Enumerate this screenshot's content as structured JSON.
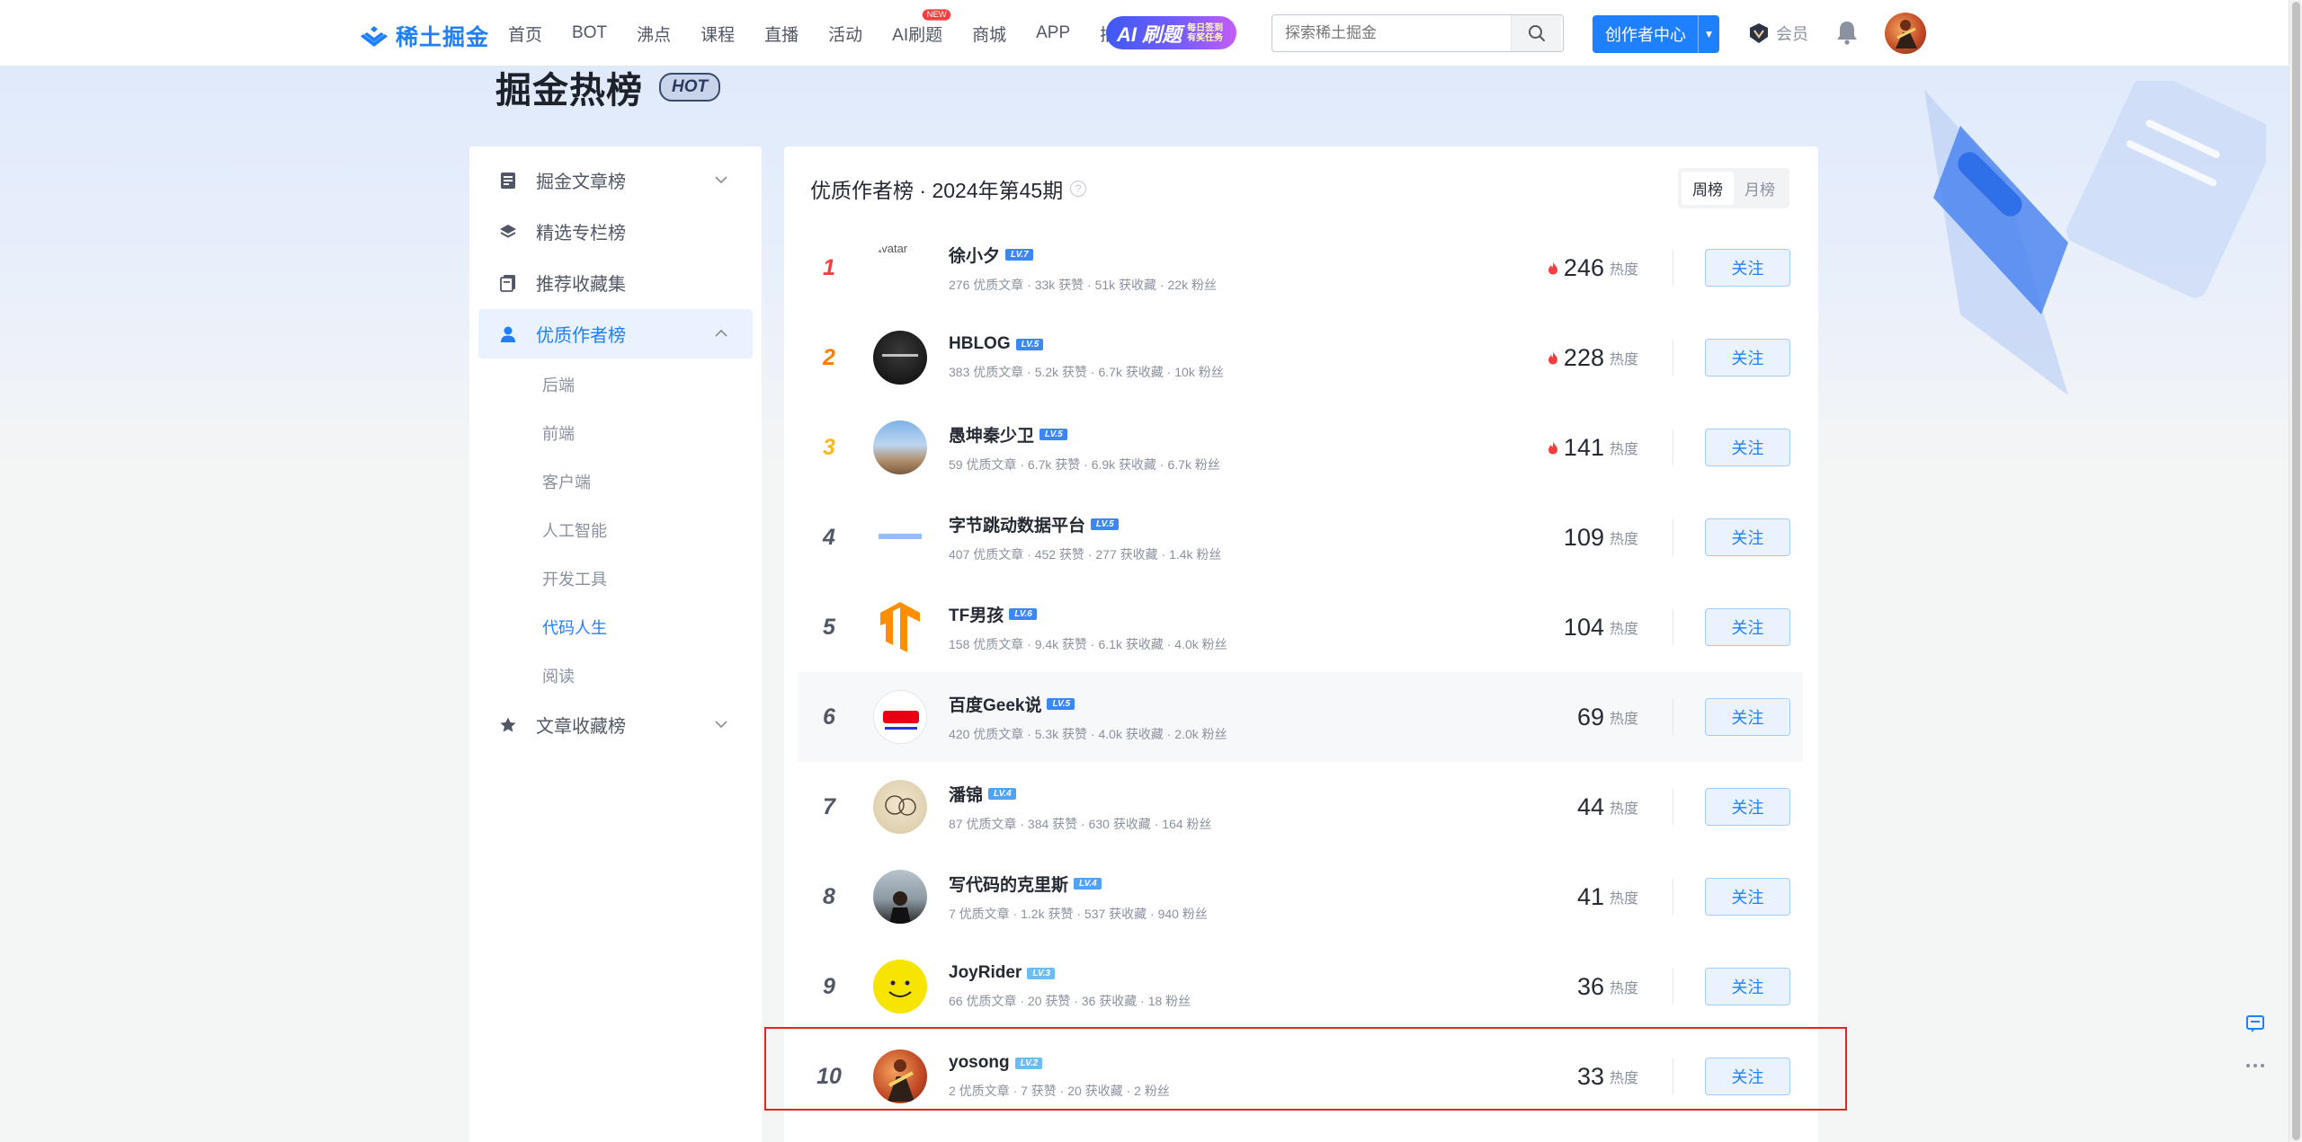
{
  "nav": {
    "logo_text": "稀土掘金",
    "items": [
      {
        "label": "首页"
      },
      {
        "label": "BOT"
      },
      {
        "label": "沸点"
      },
      {
        "label": "课程"
      },
      {
        "label": "直播"
      },
      {
        "label": "活动"
      },
      {
        "label": "AI刷题",
        "badge": "NEW"
      },
      {
        "label": "商城"
      },
      {
        "label": "APP"
      },
      {
        "label": "插件"
      }
    ],
    "ai_banner": {
      "big": "AI 刷题",
      "line1": "每日签到",
      "line2": "有奖任务"
    },
    "search_placeholder": "探索稀土掘金",
    "creator_label": "创作者中心",
    "vip_label": "会员"
  },
  "hero": {
    "title": "掘金热榜",
    "badge": "HOT"
  },
  "sidebar": {
    "items": [
      {
        "label": "掘金文章榜",
        "icon": "document-icon",
        "expanded": false
      },
      {
        "label": "精选专栏榜",
        "icon": "layers-icon"
      },
      {
        "label": "推荐收藏集",
        "icon": "collection-icon"
      },
      {
        "label": "优质作者榜",
        "icon": "user-icon",
        "expanded": true,
        "active": true
      },
      {
        "label": "文章收藏榜",
        "icon": "star-icon",
        "expanded": false
      }
    ],
    "sub_items": [
      {
        "label": "后端"
      },
      {
        "label": "前端"
      },
      {
        "label": "客户端"
      },
      {
        "label": "人工智能"
      },
      {
        "label": "开发工具"
      },
      {
        "label": "代码人生",
        "active": true
      },
      {
        "label": "阅读"
      }
    ]
  },
  "main": {
    "title": "优质作者榜 · 2024年第45期",
    "tabs": [
      {
        "label": "周榜",
        "active": true
      },
      {
        "label": "月榜"
      }
    ],
    "heat_unit": "热度",
    "follow_label": "关注",
    "authors": [
      {
        "rank": "1",
        "name": "徐小夕",
        "level": "LV.7",
        "stats": "276 优质文章 ·  33k 获赞 ·  51k 获收藏 ·  22k 粉丝",
        "heat": "246",
        "hot": true,
        "avatar_alt": "avatar"
      },
      {
        "rank": "2",
        "name": "HBLOG",
        "level": "LV.5",
        "stats": "383 优质文章 ·  5.2k 获赞 ·  6.7k 获收藏 ·  10k 粉丝",
        "heat": "228",
        "hot": true
      },
      {
        "rank": "3",
        "name": "愚坤秦少卫",
        "level": "LV.5",
        "stats": "59 优质文章 ·  6.7k 获赞 ·  6.9k 获收藏 ·  6.7k 粉丝",
        "heat": "141",
        "hot": true
      },
      {
        "rank": "4",
        "name": "字节跳动数据平台",
        "level": "LV.5",
        "stats": "407 优质文章 ·  452 获赞 ·  277 获收藏 ·  1.4k 粉丝",
        "heat": "109",
        "hot": false
      },
      {
        "rank": "5",
        "name": "TF男孩",
        "level": "LV.6",
        "stats": "158 优质文章 ·  9.4k 获赞 ·  6.1k 获收藏 ·  4.0k 粉丝",
        "heat": "104",
        "hot": false
      },
      {
        "rank": "6",
        "name": "百度Geek说",
        "level": "LV.5",
        "stats": "420 优质文章 ·  5.3k 获赞 ·  4.0k 获收藏 ·  2.0k 粉丝",
        "heat": "69",
        "hot": false
      },
      {
        "rank": "7",
        "name": "潘锦",
        "level": "LV.4",
        "stats": "87 优质文章 ·  384 获赞 ·  630 获收藏 ·  164 粉丝",
        "heat": "44",
        "hot": false
      },
      {
        "rank": "8",
        "name": "写代码的克里斯",
        "level": "LV.4",
        "stats": "7 优质文章 ·  1.2k 获赞 ·  537 获收藏 ·  940 粉丝",
        "heat": "41",
        "hot": false
      },
      {
        "rank": "9",
        "name": "JoyRider",
        "level": "LV.3",
        "stats": "66 优质文章 ·  20 获赞 ·  36 获收藏 ·  18 粉丝",
        "heat": "36",
        "hot": false
      },
      {
        "rank": "10",
        "name": "yosong",
        "level": "LV.2",
        "stats": "2 优质文章 ·  7 获赞 ·  20 获收藏 ·  2 粉丝",
        "heat": "33",
        "hot": false
      }
    ]
  },
  "colors": {
    "accent": "#1e80ff",
    "rank1": "#f53f3f",
    "rank2": "#ff7d00",
    "rank3": "#f7ba1e",
    "highlight": "#e32424"
  }
}
